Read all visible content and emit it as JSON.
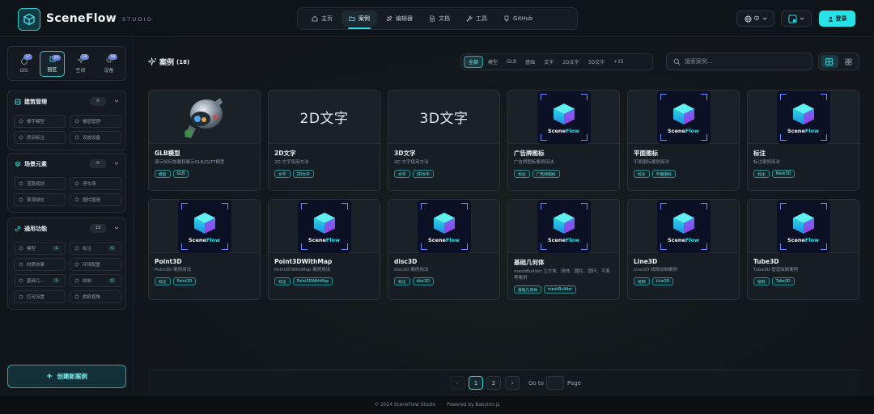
{
  "header": {
    "brand": "SceneFlow",
    "brand_sub": "STUDIO",
    "nav": [
      {
        "label": "主页",
        "icon": "home-icon"
      },
      {
        "label": "案例",
        "icon": "folder-icon"
      },
      {
        "label": "编辑器",
        "icon": "editor-icon"
      },
      {
        "label": "文档",
        "icon": "document-icon"
      },
      {
        "label": "工具",
        "icon": "wrench-icon"
      },
      {
        "label": "GitHub",
        "icon": "github-icon"
      }
    ],
    "active_nav": "案例",
    "language": "中",
    "login": "登录"
  },
  "sidebar": {
    "categories": [
      {
        "label": "GIS",
        "badge": "17"
      },
      {
        "label": "园区",
        "badge": "18"
      },
      {
        "label": "空间",
        "badge": "18"
      },
      {
        "label": "设备",
        "badge": "18"
      }
    ],
    "active_category": "园区",
    "groups": [
      {
        "title": "建筑管理",
        "count": "0",
        "items": [
          {
            "label": "楼宇模型"
          },
          {
            "label": "楼层管理"
          },
          {
            "label": "房间标注"
          },
          {
            "label": "设施设备"
          }
        ]
      },
      {
        "title": "场景元素",
        "count": "0",
        "items": [
          {
            "label": "道路规划"
          },
          {
            "label": "停车场"
          },
          {
            "label": "景观绿化"
          },
          {
            "label": "围栏围墙"
          }
        ]
      },
      {
        "title": "通用功能",
        "count": "15",
        "items": [
          {
            "label": "模型",
            "count": "1"
          },
          {
            "label": "标注",
            "count": "6"
          },
          {
            "label": "材质效果"
          },
          {
            "label": "环境配置"
          },
          {
            "label": "基础几...",
            "count": "1"
          },
          {
            "label": "绘制",
            "count": "6"
          },
          {
            "label": "灯光设置"
          },
          {
            "label": "相机视角"
          }
        ]
      }
    ],
    "create_button": "创建新案例"
  },
  "main": {
    "title": "案例",
    "count": "(18)",
    "filters": [
      "全部",
      "模型",
      "GLB",
      "基础",
      "文字",
      "2D文字",
      "3D文字",
      "+15"
    ],
    "active_filter": "全部",
    "search_placeholder": "搜索案例...",
    "cards": [
      {
        "title": "GLB模型",
        "desc": "演示如何加载和展示GLB/GLTF模型",
        "tags": [
          "模型",
          "GLB"
        ],
        "thumb": "robot"
      },
      {
        "title": "2D文字",
        "desc": "2D 文字使用方法",
        "tags": [
          "文字",
          "2D文字"
        ],
        "thumb": "text",
        "thumb_text": "2D文字"
      },
      {
        "title": "3D文字",
        "desc": "3D 文字使用方法",
        "tags": [
          "文字",
          "3D文字"
        ],
        "thumb": "text",
        "thumb_text": "3D文字"
      },
      {
        "title": "广告牌图标",
        "desc": "广告牌图标案例用法",
        "tags": [
          "标注",
          "广告牌图标"
        ],
        "thumb": "logo"
      },
      {
        "title": "平面图标",
        "desc": "平面图标案例用法",
        "tags": [
          "标注",
          "平面图标"
        ],
        "thumb": "logo"
      },
      {
        "title": "标注",
        "desc": "标注案例用法",
        "tags": [
          "标注",
          "Mark3D"
        ],
        "thumb": "logo"
      },
      {
        "title": "Point3D",
        "desc": "Point3D 案例用法",
        "tags": [
          "标注",
          "Point3D"
        ],
        "thumb": "logo"
      },
      {
        "title": "Point3DWithMap",
        "desc": "Point3DWithMap 案例用法",
        "tags": [
          "标注",
          "Point3DWithMap"
        ],
        "thumb": "logo"
      },
      {
        "title": "disc3D",
        "desc": "disc3D 案例用法",
        "tags": [
          "标注",
          "disc3D"
        ],
        "thumb": "logo"
      },
      {
        "title": "基础几何体",
        "desc": "meshBuilder 立方体、球体、圆柱、圆环、平面等案例",
        "tags": [
          "基础几何体",
          "meshBuilder"
        ],
        "thumb": "logo"
      },
      {
        "title": "Line3D",
        "desc": "Line3D 线段绘制案例",
        "tags": [
          "绘制",
          "Line3D"
        ],
        "thumb": "logo"
      },
      {
        "title": "Tube3D",
        "desc": "Tube3D 管道绘制案例",
        "tags": [
          "绘制",
          "Tube3D"
        ],
        "thumb": "logo"
      }
    ],
    "logo_text_a": "Scene",
    "logo_text_b": "Flow"
  },
  "pagination": {
    "prev": "‹",
    "pages": [
      "1",
      "2"
    ],
    "current": "1",
    "next": "›",
    "goto": "Go to",
    "page": "Page"
  },
  "footer": {
    "copyright": "© 2024 SceneFlow Studio",
    "separator": "·",
    "powered": "Powered by Babylon.js"
  },
  "colors": {
    "accent": "#27e1e7",
    "logo_bg": "#0c1024",
    "logo_corner": "#6d8dff"
  }
}
